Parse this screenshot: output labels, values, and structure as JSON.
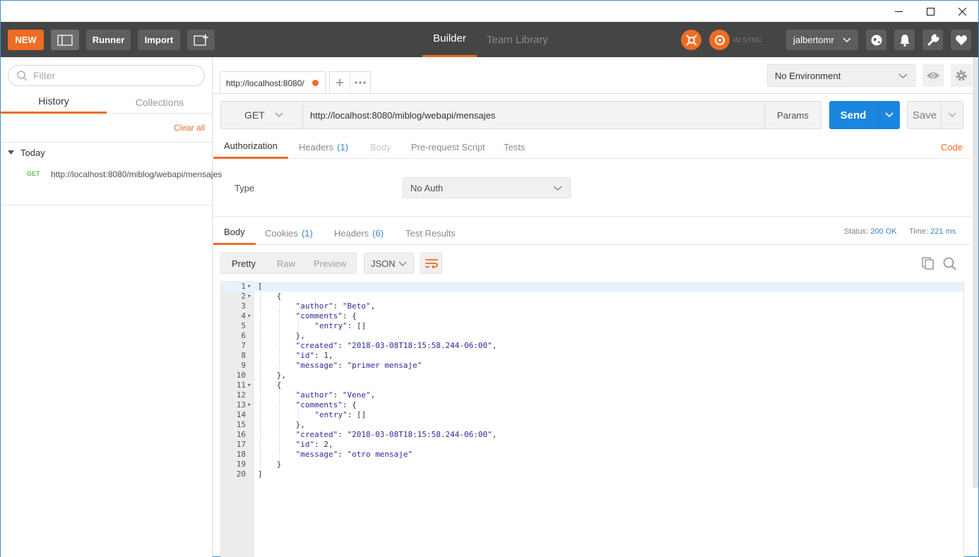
{
  "window": {
    "controls": [
      "minimize",
      "maximize",
      "close"
    ]
  },
  "topbar": {
    "new_label": "NEW",
    "runner_label": "Runner",
    "import_label": "Import",
    "builder_label": "Builder",
    "team_library_label": "Team Library",
    "sync_status": "IN SYNC",
    "username": "jalbertomr",
    "accent_color": "#ef6c23"
  },
  "sidebar": {
    "filter_placeholder": "Filter",
    "tabs": [
      "History",
      "Collections"
    ],
    "active_tab": "History",
    "clear_all": "Clear all",
    "group_label": "Today",
    "history": [
      {
        "method": "GET",
        "url": "http://localhost:8080/miblog/webapi/mensajes"
      }
    ]
  },
  "request": {
    "tab_title": "http://localhost:8080/",
    "environment": "No Environment",
    "method": "GET",
    "url": "http://localhost:8080/miblog/webapi/mensajes",
    "params_label": "Params",
    "send_label": "Send",
    "save_label": "Save",
    "tabs": {
      "authorization": "Authorization",
      "headers": "Headers",
      "headers_count": "(1)",
      "body": "Body",
      "prerequest": "Pre-request Script",
      "tests": "Tests"
    },
    "code_link": "Code",
    "auth_type_label": "Type",
    "auth_type_value": "No Auth"
  },
  "response": {
    "tabs": {
      "body": "Body",
      "cookies": "Cookies",
      "cookies_count": "(1)",
      "headers": "Headers",
      "headers_count": "(6)",
      "test_results": "Test Results"
    },
    "status_label": "Status:",
    "status_value": "200 OK",
    "time_label": "Time:",
    "time_value": "221 ms",
    "view_modes": [
      "Pretty",
      "Raw",
      "Preview"
    ],
    "active_view": "Pretty",
    "format": "JSON",
    "lines": [
      {
        "n": "1",
        "fold": true,
        "indent": 0,
        "text": "["
      },
      {
        "n": "2",
        "fold": true,
        "indent": 1,
        "text": "{"
      },
      {
        "n": "3",
        "fold": false,
        "indent": 2,
        "text": "\"author\": \"Beto\","
      },
      {
        "n": "4",
        "fold": true,
        "indent": 2,
        "text": "\"comments\": {"
      },
      {
        "n": "5",
        "fold": false,
        "indent": 3,
        "text": "\"entry\": []"
      },
      {
        "n": "6",
        "fold": false,
        "indent": 2,
        "text": "},"
      },
      {
        "n": "7",
        "fold": false,
        "indent": 2,
        "text": "\"created\": \"2018-03-08T18:15:58.244-06:00\","
      },
      {
        "n": "8",
        "fold": false,
        "indent": 2,
        "text": "\"id\": 1,"
      },
      {
        "n": "9",
        "fold": false,
        "indent": 2,
        "text": "\"message\": \"primer mensaje\""
      },
      {
        "n": "10",
        "fold": false,
        "indent": 1,
        "text": "},"
      },
      {
        "n": "11",
        "fold": true,
        "indent": 1,
        "text": "{"
      },
      {
        "n": "12",
        "fold": false,
        "indent": 2,
        "text": "\"author\": \"Vene\","
      },
      {
        "n": "13",
        "fold": true,
        "indent": 2,
        "text": "\"comments\": {"
      },
      {
        "n": "14",
        "fold": false,
        "indent": 3,
        "text": "\"entry\": []"
      },
      {
        "n": "15",
        "fold": false,
        "indent": 2,
        "text": "},"
      },
      {
        "n": "16",
        "fold": false,
        "indent": 2,
        "text": "\"created\": \"2018-03-08T18:15:58.244-06:00\","
      },
      {
        "n": "17",
        "fold": false,
        "indent": 2,
        "text": "\"id\": 2,"
      },
      {
        "n": "18",
        "fold": false,
        "indent": 2,
        "text": "\"message\": \"otro mensaje\""
      },
      {
        "n": "19",
        "fold": false,
        "indent": 1,
        "text": "}"
      },
      {
        "n": "20",
        "fold": false,
        "indent": 0,
        "text": "]"
      }
    ]
  }
}
